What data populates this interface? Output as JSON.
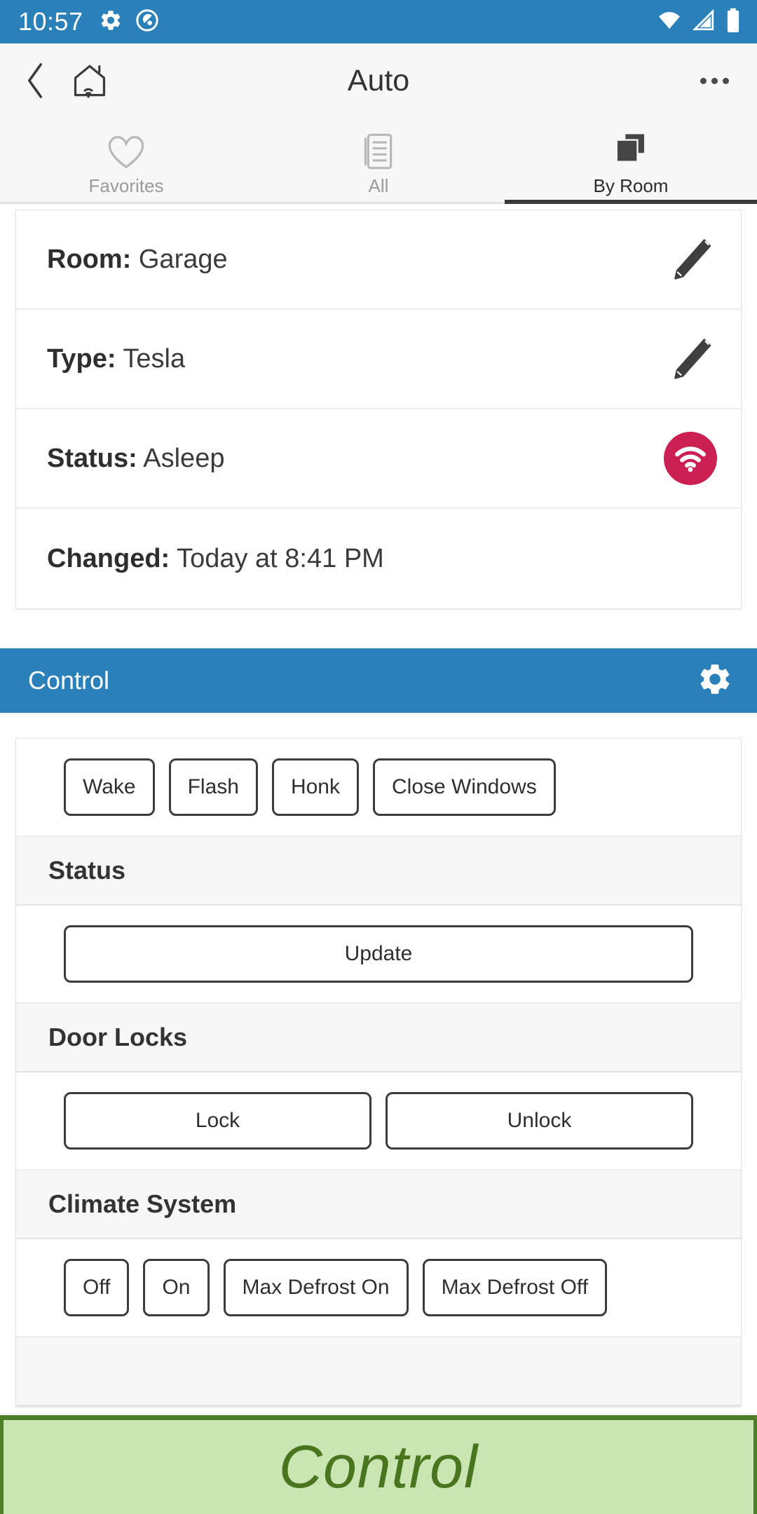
{
  "statusbar": {
    "time": "10:57",
    "icons": [
      "gear-icon",
      "do-not-disturb-icon"
    ],
    "right_icons": [
      "wifi-icon",
      "cell-signal-icon",
      "battery-icon"
    ],
    "background": "#2A80B9"
  },
  "appbar": {
    "back_label": "back-chevron-icon",
    "home_label": "home-wifi-icon",
    "title": "Auto",
    "overflow_label": "overflow-menu-icon"
  },
  "tabs": [
    {
      "label": "Favorites",
      "icon": "heart-icon",
      "active": false
    },
    {
      "label": "All",
      "icon": "list-document-icon",
      "active": false
    },
    {
      "label": "By Room",
      "icon": "rooms-stacked-squares-icon",
      "active": true
    }
  ],
  "info_card": {
    "rows": [
      {
        "label": "Room:",
        "value": "Garage",
        "action": "edit-pencil-icon"
      },
      {
        "label": "Type:",
        "value": "Tesla",
        "action": "edit-pencil-icon"
      },
      {
        "label": "Status:",
        "value": "Asleep",
        "action": "wifi-status-icon"
      },
      {
        "label": "Changed:",
        "value": "Today at 8:41 PM",
        "action": ""
      }
    ],
    "status_badge_color": "#CC2052"
  },
  "control": {
    "header_title": "Control",
    "header_color": "#2A80B9",
    "settings_label": "gear-icon",
    "groups": [
      {
        "section": "",
        "buttons": [
          "Wake",
          "Flash",
          "Honk",
          "Close Windows"
        ]
      },
      {
        "section": "Status",
        "buttons": [
          "Update"
        ]
      },
      {
        "section": "Door Locks",
        "buttons": [
          "Lock",
          "Unlock"
        ]
      },
      {
        "section": "Climate System",
        "buttons": [
          "Off",
          "On",
          "Max Defrost On",
          "Max Defrost Off"
        ]
      }
    ]
  },
  "banner": {
    "text": "Control",
    "background": "#C9E5B2",
    "border_color": "#4E7F26",
    "text_color": "#49751F"
  }
}
